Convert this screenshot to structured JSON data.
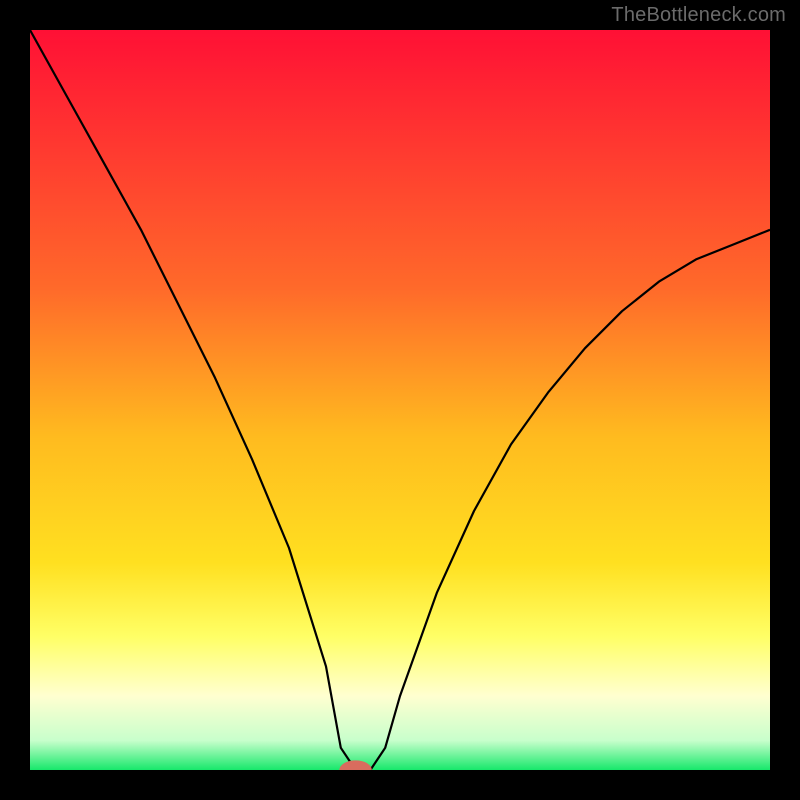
{
  "watermark": "TheBottleneck.com",
  "chart_data": {
    "type": "line",
    "title": "",
    "xlabel": "",
    "ylabel": "",
    "xlim": [
      0,
      100
    ],
    "ylim": [
      0,
      100
    ],
    "grid": false,
    "gradient_stops": [
      {
        "offset": 0,
        "color": "#ff1035"
      },
      {
        "offset": 35,
        "color": "#ff6a2a"
      },
      {
        "offset": 55,
        "color": "#ffbb1f"
      },
      {
        "offset": 72,
        "color": "#ffe020"
      },
      {
        "offset": 82,
        "color": "#ffff66"
      },
      {
        "offset": 90,
        "color": "#ffffd0"
      },
      {
        "offset": 96,
        "color": "#c8ffcc"
      },
      {
        "offset": 100,
        "color": "#17e86b"
      }
    ],
    "optimum_x": 44,
    "marker": {
      "x": 44,
      "y": 0,
      "color": "#d96c5e",
      "rx": 2.2,
      "ry": 1.3
    },
    "series": [
      {
        "name": "bottleneck-curve",
        "color": "#000000",
        "stroke_width": 2.2,
        "x": [
          0,
          5,
          10,
          15,
          20,
          25,
          30,
          35,
          40,
          42,
          44,
          46,
          48,
          50,
          55,
          60,
          65,
          70,
          75,
          80,
          85,
          90,
          95,
          100
        ],
        "values": [
          100,
          91,
          82,
          73,
          63,
          53,
          42,
          30,
          14,
          3,
          0,
          0,
          3,
          10,
          24,
          35,
          44,
          51,
          57,
          62,
          66,
          69,
          71,
          73
        ]
      }
    ]
  }
}
